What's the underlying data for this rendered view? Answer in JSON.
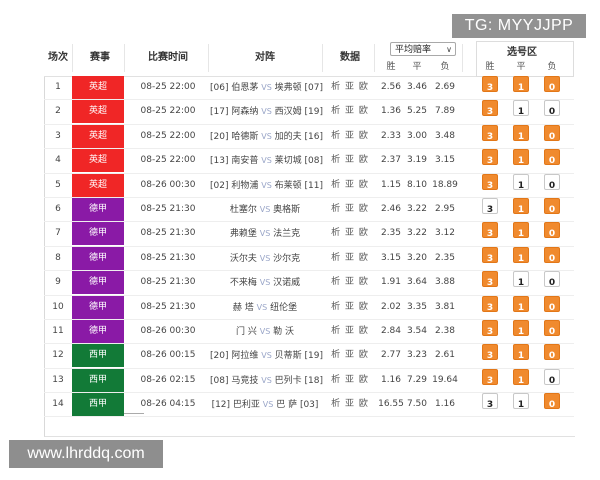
{
  "watermark_top": "TG: MYYJJPP",
  "watermark_bottom": "www.lhrddq.com",
  "header": {
    "no": "场次",
    "league": "赛事",
    "time": "比赛时间",
    "match": "对阵",
    "data": "数据",
    "odds_select": "平均赔率",
    "odds_win": "胜",
    "odds_draw": "平",
    "odds_loss": "负",
    "pick_title": "选号区",
    "pick_win": "胜",
    "pick_draw": "平",
    "pick_loss": "负"
  },
  "colors": {
    "epl": "#f02626",
    "bundesliga": "#8a1aa6",
    "laliga": "#127a37",
    "pick_active": "#f08a2e"
  },
  "rows": [
    {
      "no": "1",
      "league": "英超",
      "league_color": "#f02626",
      "time": "08-25 22:00",
      "home": "[06] 伯恩茅",
      "away": "埃弗顿 [07]",
      "data": "析 亚 欧",
      "w": "2.56",
      "d": "3.46",
      "l": "2.69",
      "pick_w": "3",
      "pick_d": "1",
      "pick_l": "0",
      "sel": [
        true,
        true,
        true
      ]
    },
    {
      "no": "2",
      "league": "英超",
      "league_color": "#f02626",
      "time": "08-25 22:00",
      "home": "[17] 阿森纳",
      "away": "西汉姆 [19]",
      "data": "析 亚 欧",
      "w": "1.36",
      "d": "5.25",
      "l": "7.89",
      "pick_w": "3",
      "pick_d": "1",
      "pick_l": "0",
      "sel": [
        true,
        false,
        false
      ]
    },
    {
      "no": "3",
      "league": "英超",
      "league_color": "#f02626",
      "time": "08-25 22:00",
      "home": "[20] 哈德斯",
      "away": "加的夫 [16]",
      "data": "析 亚 欧",
      "w": "2.33",
      "d": "3.00",
      "l": "3.48",
      "pick_w": "3",
      "pick_d": "1",
      "pick_l": "0",
      "sel": [
        true,
        true,
        true
      ]
    },
    {
      "no": "4",
      "league": "英超",
      "league_color": "#f02626",
      "time": "08-25 22:00",
      "home": "[13] 南安普",
      "away": "莱切城 [08]",
      "data": "析 亚 欧",
      "w": "2.37",
      "d": "3.19",
      "l": "3.15",
      "pick_w": "3",
      "pick_d": "1",
      "pick_l": "0",
      "sel": [
        true,
        true,
        true
      ]
    },
    {
      "no": "5",
      "league": "英超",
      "league_color": "#f02626",
      "time": "08-26 00:30",
      "home": "[02] 利物浦",
      "away": "布莱顿 [11]",
      "data": "析 亚 欧",
      "w": "1.15",
      "d": "8.10",
      "l": "18.89",
      "pick_w": "3",
      "pick_d": "1",
      "pick_l": "0",
      "sel": [
        true,
        false,
        false
      ]
    },
    {
      "no": "6",
      "league": "德甲",
      "league_color": "#8a1aa6",
      "time": "08-25 21:30",
      "home": "杜塞尔",
      "away": "奥格斯",
      "data": "析 亚 欧",
      "w": "2.46",
      "d": "3.22",
      "l": "2.95",
      "pick_w": "3",
      "pick_d": "1",
      "pick_l": "0",
      "sel": [
        false,
        true,
        true
      ]
    },
    {
      "no": "7",
      "league": "德甲",
      "league_color": "#8a1aa6",
      "time": "08-25 21:30",
      "home": "弗赖堡",
      "away": "法兰克",
      "data": "析 亚 欧",
      "w": "2.35",
      "d": "3.22",
      "l": "3.12",
      "pick_w": "3",
      "pick_d": "1",
      "pick_l": "0",
      "sel": [
        true,
        true,
        true
      ]
    },
    {
      "no": "8",
      "league": "德甲",
      "league_color": "#8a1aa6",
      "time": "08-25 21:30",
      "home": "沃尔夫",
      "away": "沙尔克",
      "data": "析 亚 欧",
      "w": "3.15",
      "d": "3.20",
      "l": "2.35",
      "pick_w": "3",
      "pick_d": "1",
      "pick_l": "0",
      "sel": [
        true,
        true,
        true
      ]
    },
    {
      "no": "9",
      "league": "德甲",
      "league_color": "#8a1aa6",
      "time": "08-25 21:30",
      "home": "不来梅",
      "away": "汉诺威",
      "data": "析 亚 欧",
      "w": "1.91",
      "d": "3.64",
      "l": "3.88",
      "pick_w": "3",
      "pick_d": "1",
      "pick_l": "0",
      "sel": [
        true,
        false,
        false
      ]
    },
    {
      "no": "10",
      "league": "德甲",
      "league_color": "#8a1aa6",
      "time": "08-25 21:30",
      "home": "赫 塔",
      "away": "纽伦堡",
      "data": "析 亚 欧",
      "w": "2.02",
      "d": "3.35",
      "l": "3.81",
      "pick_w": "3",
      "pick_d": "1",
      "pick_l": "0",
      "sel": [
        true,
        true,
        true
      ]
    },
    {
      "no": "11",
      "league": "德甲",
      "league_color": "#8a1aa6",
      "time": "08-26 00:30",
      "home": "门 兴",
      "away": "勒 沃",
      "data": "析 亚 欧",
      "w": "2.84",
      "d": "3.54",
      "l": "2.38",
      "pick_w": "3",
      "pick_d": "1",
      "pick_l": "0",
      "sel": [
        true,
        true,
        true
      ]
    },
    {
      "no": "12",
      "league": "西甲",
      "league_color": "#127a37",
      "time": "08-26 00:15",
      "home": "[20] 阿拉维",
      "away": "贝蒂斯 [19]",
      "data": "析 亚 欧",
      "w": "2.77",
      "d": "3.23",
      "l": "2.61",
      "pick_w": "3",
      "pick_d": "1",
      "pick_l": "0",
      "sel": [
        true,
        true,
        true
      ]
    },
    {
      "no": "13",
      "league": "西甲",
      "league_color": "#127a37",
      "time": "08-26 02:15",
      "home": "[08] 马竞技",
      "away": "巴列卡 [18]",
      "data": "析 亚 欧",
      "w": "1.16",
      "d": "7.29",
      "l": "19.64",
      "pick_w": "3",
      "pick_d": "1",
      "pick_l": "0",
      "sel": [
        true,
        true,
        false
      ]
    },
    {
      "no": "14",
      "league": "西甲",
      "league_color": "#127a37",
      "time": "08-26 04:15",
      "home": "[12] 巴利亚",
      "away": "巴 萨 [03]",
      "data": "析 亚 欧",
      "w": "16.55",
      "d": "7.50",
      "l": "1.16",
      "pick_w": "3",
      "pick_d": "1",
      "pick_l": "0",
      "sel": [
        false,
        false,
        true
      ]
    }
  ]
}
